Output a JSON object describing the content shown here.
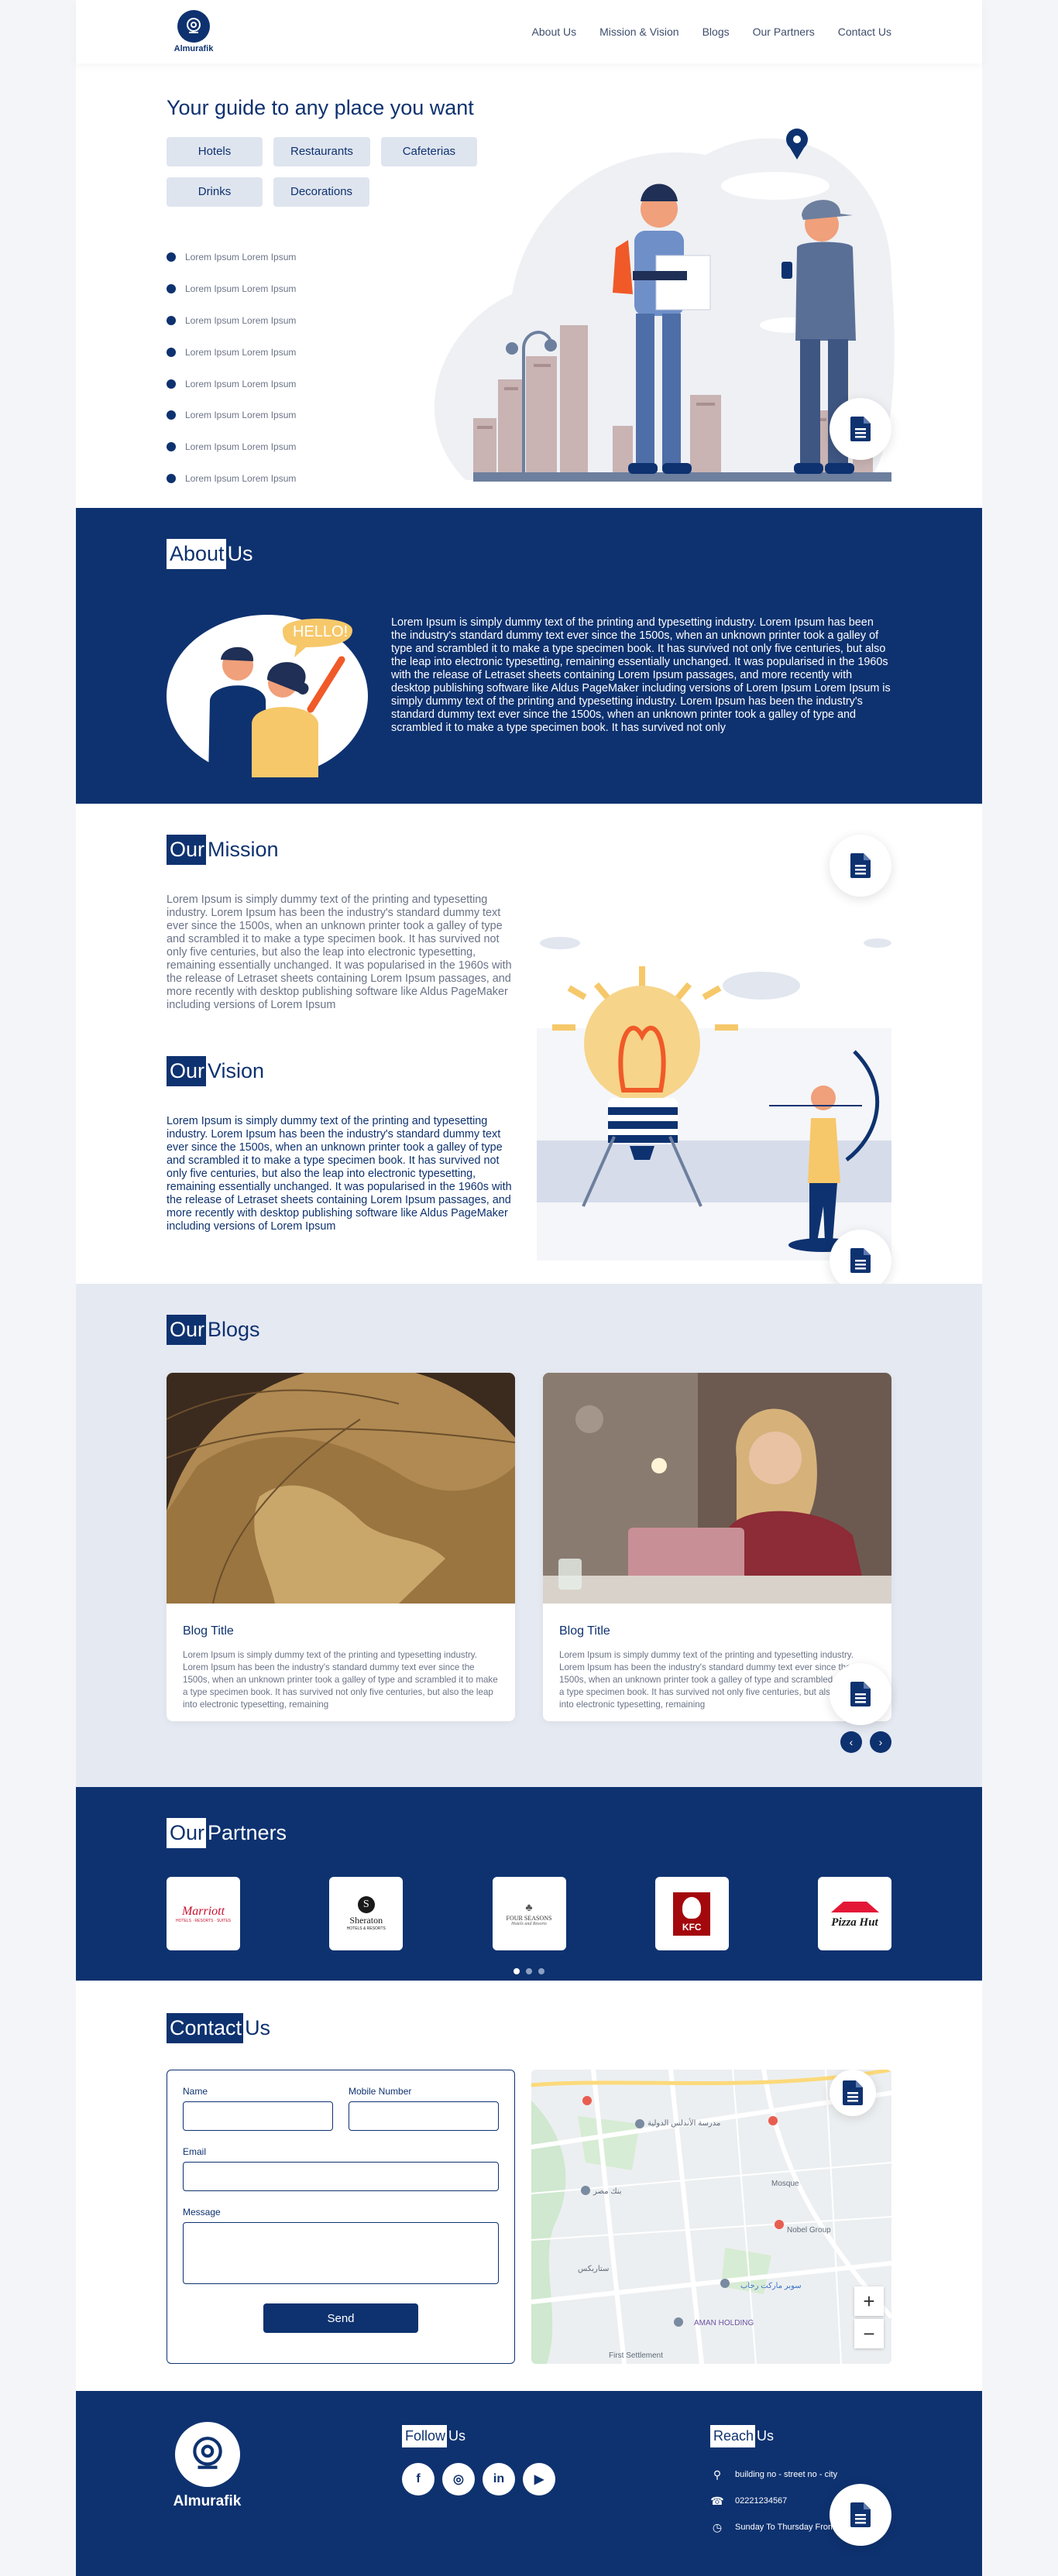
{
  "nav": {
    "brand": "Almurafik",
    "links": [
      "About Us",
      "Mission & Vision",
      "Blogs",
      "Our Partners",
      "Contact Us"
    ]
  },
  "hero": {
    "title": "Your guide to any place you want",
    "chips": [
      "Hotels",
      "Restaurants",
      "Cafeterias",
      "Drinks",
      "Decorations"
    ],
    "bullets": [
      "Lorem Ipsum Lorem Ipsum",
      "Lorem Ipsum Lorem Ipsum",
      "Lorem Ipsum Lorem Ipsum",
      "Lorem Ipsum Lorem Ipsum",
      "Lorem Ipsum Lorem Ipsum",
      "Lorem Ipsum Lorem Ipsum",
      "Lorem Ipsum Lorem Ipsum",
      "Lorem Ipsum Lorem Ipsum"
    ]
  },
  "about": {
    "title_box": "About",
    "title_rest": "Us",
    "bubble": "HELLO!",
    "text": "Lorem Ipsum is simply dummy text of the printing and typesetting industry. Lorem Ipsum has been the industry's standard dummy text ever since the 1500s, when an unknown printer took a galley of type and scrambled it to make a type specimen book. It has survived not only five centuries, but also the leap into electronic typesetting, remaining essentially unchanged. It was popularised in the 1960s with the release of Letraset sheets containing Lorem Ipsum passages, and more recently with desktop publishing software like Aldus PageMaker including versions of Lorem Ipsum Lorem Ipsum is simply dummy text of the printing and typesetting industry. Lorem Ipsum has been the industry's standard dummy text ever since the 1500s, when an unknown printer took a galley of type and scrambled it to make a type specimen book. It has survived not only"
  },
  "mission": {
    "title_box": "Our",
    "title_rest": "Mission",
    "text": "Lorem Ipsum is simply dummy text of the printing and typesetting industry. Lorem Ipsum has been the industry's standard dummy text ever since the 1500s, when an unknown printer took a galley of type and scrambled it to make a type specimen book. It has survived not only five centuries, but also the leap into electronic typesetting, remaining essentially unchanged. It was popularised in the 1960s with the release of Letraset sheets containing Lorem Ipsum passages, and more recently with desktop publishing software like Aldus PageMaker including versions of Lorem Ipsum"
  },
  "vision": {
    "title_box": "Our",
    "title_rest": "Vision",
    "text": "Lorem Ipsum is simply dummy text of the printing and typesetting industry. Lorem Ipsum has been the industry's standard dummy text ever since the 1500s, when an unknown printer took a galley of type and scrambled it to make a type specimen book. It has survived not only five centuries, but also the leap into electronic typesetting, remaining essentially unchanged. It was popularised in the 1960s with the release of Letraset sheets containing Lorem Ipsum passages, and more recently with desktop publishing software like Aldus PageMaker including versions of Lorem Ipsum"
  },
  "blogs": {
    "title_box": "Our",
    "title_rest": "Blogs",
    "cards": [
      {
        "title": "Blog Title",
        "text": "Lorem Ipsum is simply dummy text of the printing and typesetting industry. Lorem Ipsum has been the industry's standard dummy text ever since the 1500s, when an unknown printer took a galley of type and scrambled it to make a type specimen book. It has survived not only five centuries, but also the leap into electronic typesetting, remaining"
      },
      {
        "title": "Blog Title",
        "text": "Lorem Ipsum is simply dummy text of the printing and typesetting industry. Lorem Ipsum has been the industry's standard dummy text ever since the 1500s, when an unknown printer took a galley of type and scrambled it to make a type specimen book. It has survived not only five centuries, but also the leap into electronic typesetting, remaining"
      }
    ],
    "prev": "‹",
    "next": "›"
  },
  "partners": {
    "title_box": "Our",
    "title_rest": "Partners",
    "logos": [
      {
        "name": "Marriott",
        "sub": "HOTELS · RESORTS · SUITES",
        "color": "#c8102e"
      },
      {
        "name": "Sheraton",
        "sub": "HOTELS & RESORTS",
        "color": "#1a1a1a"
      },
      {
        "name": "FOUR SEASONS",
        "sub": "Hotels and Resorts",
        "color": "#333333"
      },
      {
        "name": "KFC",
        "sub": "",
        "color": "#a3080c"
      },
      {
        "name": "Pizza Hut",
        "sub": "",
        "color": "#e31837"
      }
    ]
  },
  "contact": {
    "title_box": "Contact",
    "title_rest": "Us",
    "name_label": "Name",
    "mobile_label": "Mobile Number",
    "email_label": "Email",
    "message_label": "Message",
    "send_label": "Send",
    "map_labels": [
      "مدرسة الأندلس الدولية",
      "بنك مصر",
      "Nobel Group",
      "AMAN HOLDING",
      "First Settlement",
      "ستاربكس",
      "سوبر ماركت رحاب",
      "Mosque"
    ],
    "zoom_in": "+",
    "zoom_out": "−"
  },
  "footer": {
    "brand": "Almurafik",
    "follow_box": "Follow",
    "follow_rest": "Us",
    "socials": [
      "f",
      "◎",
      "in",
      "▶"
    ],
    "reach_box": "Reach",
    "reach_rest": "Us",
    "address": "building no - street no - city",
    "phone": "02221234567",
    "hours": "Sunday To Thursday From"
  },
  "colors": {
    "navy": "#0e3270",
    "light_bg": "#e5e9f2",
    "chip_bg": "#dfe5ef"
  },
  "icons": [
    "location-pin-icon",
    "document-icon",
    "phone-icon",
    "clock-icon",
    "facebook-icon",
    "instagram-icon",
    "linkedin-icon",
    "youtube-icon"
  ]
}
